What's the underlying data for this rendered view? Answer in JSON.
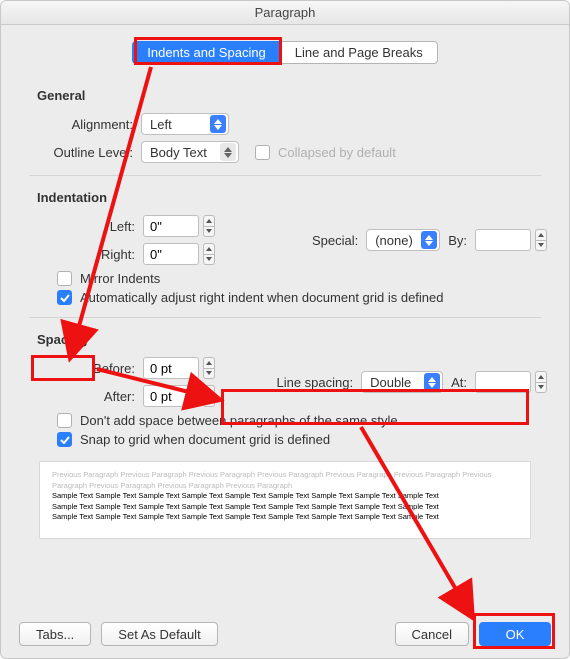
{
  "window": {
    "title": "Paragraph"
  },
  "tabs": {
    "indents": "Indents and Spacing",
    "linebreaks": "Line and Page Breaks"
  },
  "general": {
    "header": "General",
    "alignment_label": "Alignment:",
    "alignment_value": "Left",
    "outline_label": "Outline Level:",
    "outline_value": "Body Text",
    "collapsed_label": "Collapsed by default"
  },
  "indentation": {
    "header": "Indentation",
    "left_label": "Left:",
    "left_value": "0\"",
    "right_label": "Right:",
    "right_value": "0\"",
    "special_label": "Special:",
    "special_value": "(none)",
    "by_label": "By:",
    "mirror_label": "Mirror Indents",
    "auto_label": "Automatically adjust right indent when document grid is defined"
  },
  "spacing": {
    "header": "Spacing",
    "before_label": "Before:",
    "before_value": "0 pt",
    "after_label": "After:",
    "after_value": "0 pt",
    "line_spacing_label": "Line spacing:",
    "line_spacing_value": "Double",
    "at_label": "At:",
    "noadd_label": "Don't add space between paragraphs of the same style",
    "snap_label": "Snap to grid when document grid is defined"
  },
  "preview": {
    "gray_text": "Previous Paragraph Previous Paragraph Previous Paragraph Previous Paragraph Previous Paragraph Previous Paragraph Previous Paragraph Previous Paragraph Previous Paragraph Previous Paragraph",
    "sample_text": "Sample Text Sample Text Sample Text Sample Text Sample Text Sample Text Sample Text Sample Text Sample Text"
  },
  "footer": {
    "tabs": "Tabs...",
    "setdefault": "Set As Default",
    "cancel": "Cancel",
    "ok": "OK"
  }
}
